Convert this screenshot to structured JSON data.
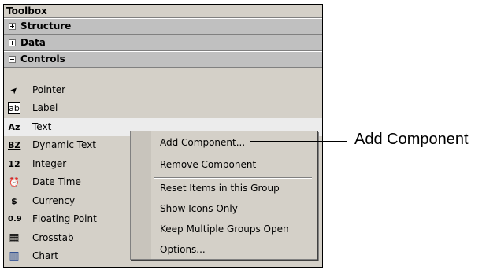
{
  "toolbox": {
    "title": "Toolbox",
    "groups": [
      {
        "label": "Structure",
        "expanded": false
      },
      {
        "label": "Data",
        "expanded": false
      },
      {
        "label": "Controls",
        "expanded": true
      }
    ],
    "items": [
      {
        "icon": "pointer-icon",
        "glyph": "➤",
        "label": "Pointer"
      },
      {
        "icon": "label-icon",
        "glyph": "ab",
        "label": "Label"
      },
      {
        "icon": "text-icon",
        "glyph": "Az",
        "label": "Text"
      },
      {
        "icon": "dynamic-text-icon",
        "glyph": "BZ",
        "label": "Dynamic Text"
      },
      {
        "icon": "integer-icon",
        "glyph": "12",
        "label": "Integer"
      },
      {
        "icon": "date-time-icon",
        "glyph": "⏰",
        "label": "Date Time"
      },
      {
        "icon": "currency-icon",
        "glyph": "$",
        "label": "Currency"
      },
      {
        "icon": "floating-point-icon",
        "glyph": "0.9",
        "label": "Floating Point"
      },
      {
        "icon": "crosstab-icon",
        "glyph": "▦",
        "label": "Crosstab"
      },
      {
        "icon": "chart-icon",
        "glyph": "▥",
        "label": "Chart"
      }
    ]
  },
  "context_menu": {
    "items": [
      "Add Component...",
      "Remove Component",
      "Reset Items in this Group",
      "Show Icons Only",
      "Keep Multiple Groups Open",
      "Options..."
    ]
  },
  "callout": {
    "text": "Add Component"
  }
}
